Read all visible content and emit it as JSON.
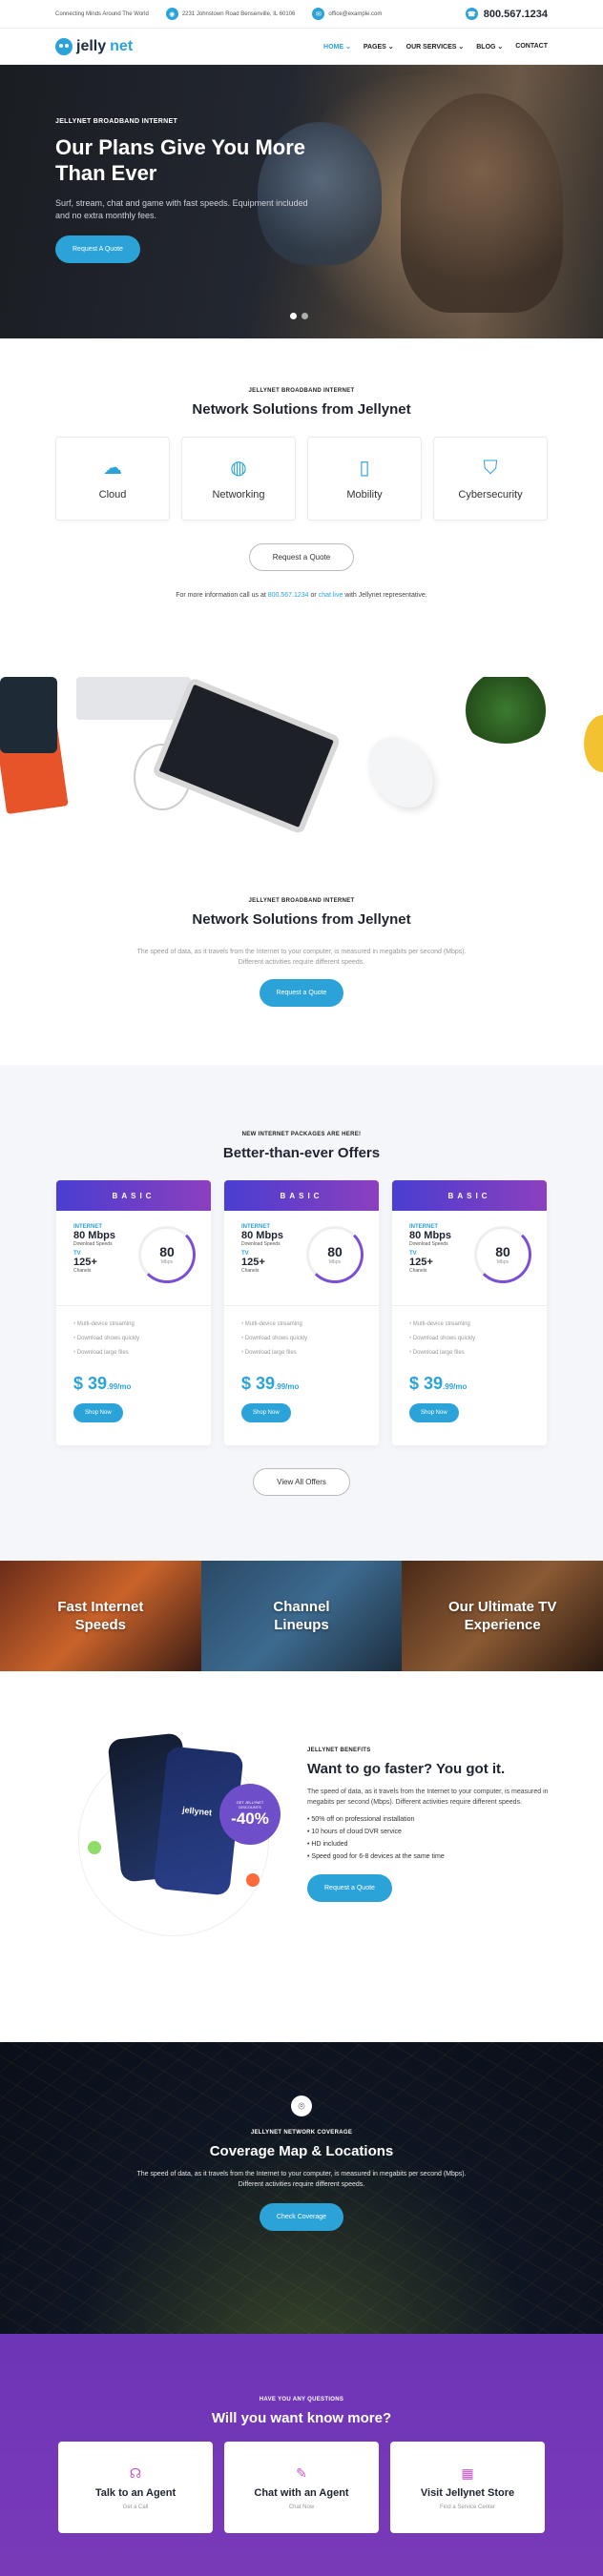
{
  "topbar": {
    "tagline": "Connecting Minds Around The World",
    "address": "2231 Johnstown Road Bensenville, IL 60106",
    "email": "office@example.com",
    "phone": "800.567.1234"
  },
  "nav": {
    "logo_part1": "jelly",
    "logo_part2": "net",
    "items": [
      "HOME",
      "PAGES",
      "OUR SERVICES",
      "BLOG",
      "CONTACT"
    ]
  },
  "hero": {
    "kicker": "JELLYNET BROADBAND INTERNET",
    "title": "Our Plans Give You More Than Ever",
    "text": "Surf, stream, chat and game with fast speeds. Equipment included and no extra monthly fees.",
    "button": "Request A Quote"
  },
  "solutions": {
    "kicker": "JELLYNET BROADBAND INTERNET",
    "title": "Network Solutions from Jellynet",
    "cards": [
      "Cloud",
      "Networking",
      "Mobility",
      "Cybersecurity"
    ],
    "button": "Request a Quote",
    "info_pre": "For more information call us at ",
    "info_phone": "800.567.1234",
    "info_mid": " or ",
    "info_chat": "chat live",
    "info_post": " with Jellynet representative."
  },
  "speed": {
    "kicker": "JELLYNET BROADBAND INTERNET",
    "title": "Network Solutions from Jellynet",
    "text": "The speed of data, as it travels from the Internet to your computer, is measured in megabits per second (Mbps). Different activities require different speeds.",
    "button": "Request a Quote"
  },
  "offers": {
    "kicker": "NEW INTERNET PACKAGES ARE HERE!",
    "title": "Better-than-ever Offers",
    "plans": [
      {
        "name": "BASIC",
        "label": "INTERNET",
        "speed": "80 Mbps",
        "speed_sub": "Download Speeds",
        "tv": "TV",
        "channels": "125+",
        "channels_sub": "Chanels",
        "gauge": "80",
        "gauge_unit": "Mbps",
        "features": [
          "Multi-device streaming",
          "Download shows quickly",
          "Download large files"
        ],
        "price": "39",
        "price_suffix": ".99/mo",
        "button": "Shop Now"
      },
      {
        "name": "BASIC",
        "label": "INTERNET",
        "speed": "80 Mbps",
        "speed_sub": "Download Speeds",
        "tv": "TV",
        "channels": "125+",
        "channels_sub": "Chanels",
        "gauge": "80",
        "gauge_unit": "Mbps",
        "features": [
          "Multi-device streaming",
          "Download shows quickly",
          "Download large files"
        ],
        "price": "39",
        "price_suffix": ".99/mo",
        "button": "Shop Now"
      },
      {
        "name": "BASIC",
        "label": "INTERNET",
        "speed": "80 Mbps",
        "speed_sub": "Download Speeds",
        "tv": "TV",
        "channels": "125+",
        "channels_sub": "Chanels",
        "gauge": "80",
        "gauge_unit": "Mbps",
        "features": [
          "Multi-device streaming",
          "Download shows quickly",
          "Download large files"
        ],
        "price": "39",
        "price_suffix": ".99/mo",
        "button": "Shop Now"
      }
    ],
    "button": "View All Offers"
  },
  "banners": [
    "Fast Internet Speeds",
    "Channel Lineups",
    "Our Ultimate TV Experience"
  ],
  "faster": {
    "badge_text": "GET JELLYNET DISCOUNTS",
    "badge_value": "-40%",
    "phone_logo": "jellynet",
    "kicker": "JELLYNET BENEFITS",
    "title": "Want to go faster? You got it.",
    "text": "The speed of data, as it travels from the Internet to your computer, is measured in megabits per second (Mbps). Different activities require different speeds.",
    "bullets": [
      "50% off on professional installation",
      "10 hours of cloud DVR service",
      "HD included",
      "Speed good for 6-8 devices at the same time"
    ],
    "button": "Request a Quote"
  },
  "coverage": {
    "kicker": "JELLYNET NETWORK COVERAGE",
    "title": "Coverage Map & Locations",
    "text": "The speed of data, as it travels from the Internet to your computer, is measured in megabits per second (Mbps). Different activities require different speeds.",
    "button": "Check Coverage"
  },
  "contact": {
    "kicker": "HAVE YOU ANY QUESTIONS",
    "title": "Will you want know more?",
    "cards": [
      {
        "title": "Talk to an Agent",
        "sub": "Get a Call"
      },
      {
        "title": "Chat with an Agent",
        "sub": "Chat Now"
      },
      {
        "title": "Visit Jellynet Store",
        "sub": "Find a Service Center"
      }
    ]
  },
  "colors": {
    "accent": "#2ba3d9",
    "purple": "#6d35b7",
    "dark": "#1f2430"
  }
}
